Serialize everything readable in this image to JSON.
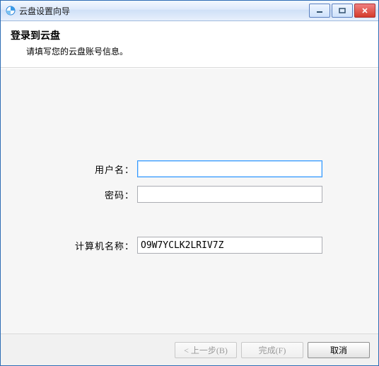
{
  "window": {
    "title": "云盘设置向导"
  },
  "header": {
    "title": "登录到云盘",
    "subtitle": "请填写您的云盘账号信息。"
  },
  "form": {
    "username_label": "用户名：",
    "username_value": "",
    "password_label": "密码：",
    "password_value": "",
    "computer_label": "计算机名称：",
    "computer_value": "O9W7YCLK2LRIV7Z"
  },
  "footer": {
    "back_label": "< 上一步(B)",
    "finish_label": "完成(F)",
    "cancel_label": "取消"
  }
}
